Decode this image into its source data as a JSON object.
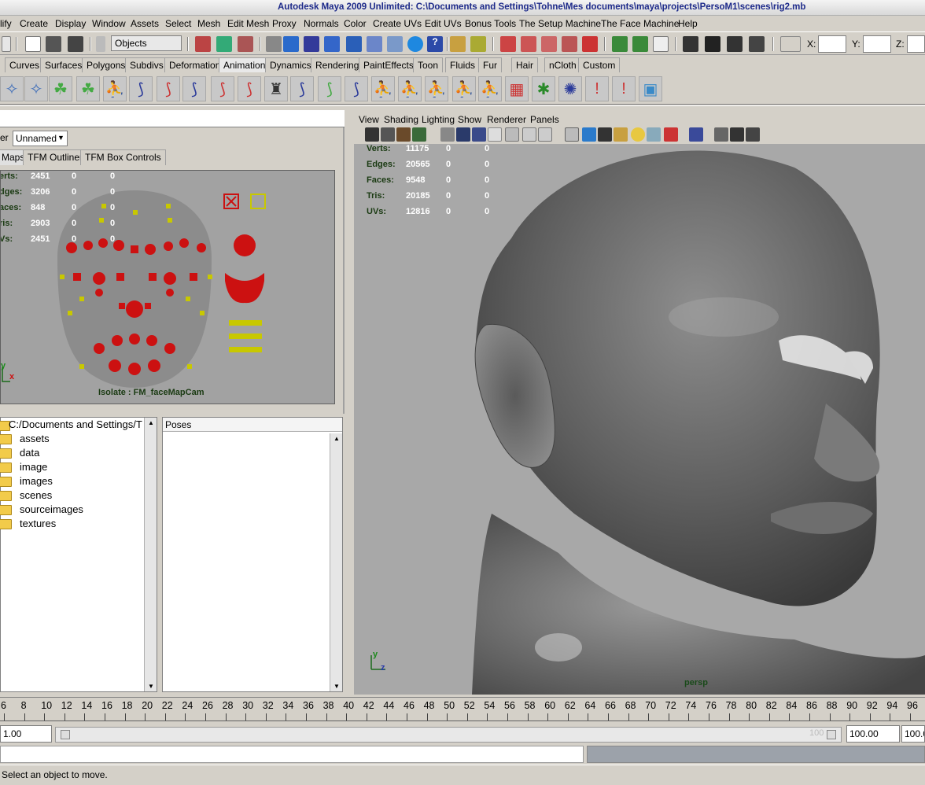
{
  "window": {
    "title": "Autodesk Maya 2009 Unlimited: C:\\Documents and Settings\\Tohne\\Mes documents\\maya\\projects\\PersoM1\\scenes\\rig2.mb"
  },
  "menubar": [
    "lify",
    "Create",
    "Display",
    "Window",
    "Assets",
    "Select",
    "Mesh",
    "Edit Mesh",
    "Proxy",
    "Normals",
    "Color",
    "Create UVs",
    "Edit UVs",
    "Bonus Tools",
    "The Setup Machine",
    "The Face Machine",
    "Help"
  ],
  "statusline": {
    "selection_mode": "Objects",
    "x_label": "X:",
    "y_label": "Y:",
    "z_label": "Z:"
  },
  "shelf_tabs": [
    "Curves",
    "Surfaces",
    "Polygons",
    "Subdivs",
    "Deformation",
    "Animation",
    "Dynamics",
    "Rendering",
    "PaintEffects",
    "Toon",
    "Fluids",
    "Fur",
    "Hair",
    "nCloth",
    "Custom"
  ],
  "shelf_active": "Animation",
  "left_panel": {
    "er_label": "er",
    "dropdown_value": "Unnamed",
    "tabs": [
      "Maps",
      "TFM Outliner",
      "TFM Box Controls"
    ],
    "active_tab": "Maps",
    "hud": [
      {
        "label": "erts:",
        "v1": "2451",
        "v2": "0",
        "v3": "0"
      },
      {
        "label": "dges:",
        "v1": "3206",
        "v2": "0",
        "v3": "0"
      },
      {
        "label": "aces:",
        "v1": "848",
        "v2": "0",
        "v3": "0"
      },
      {
        "label": "ris:",
        "v1": "2903",
        "v2": "0",
        "v3": "0"
      },
      {
        "label": "Vs:",
        "v1": "2451",
        "v2": "0",
        "v3": "0"
      }
    ],
    "isolate_label": "Isolate : FM_faceMapCam",
    "axis_x": "x",
    "axis_y": "y"
  },
  "file_browser": {
    "path": "C:/Documents and Settings/T",
    "folders": [
      "assets",
      "data",
      "image",
      "images",
      "scenes",
      "sourceimages",
      "textures"
    ]
  },
  "poses": {
    "header": "Poses"
  },
  "viewport": {
    "menu": [
      "View",
      "Shading",
      "Lighting",
      "Show",
      "Renderer",
      "Panels"
    ],
    "hud": [
      {
        "label": "Verts:",
        "v1": "11175",
        "v2": "0",
        "v3": "0"
      },
      {
        "label": "Edges:",
        "v1": "20565",
        "v2": "0",
        "v3": "0"
      },
      {
        "label": "Faces:",
        "v1": "9548",
        "v2": "0",
        "v3": "0"
      },
      {
        "label": "Tris:",
        "v1": "20185",
        "v2": "0",
        "v3": "0"
      },
      {
        "label": "UVs:",
        "v1": "12816",
        "v2": "0",
        "v3": "0"
      }
    ],
    "camera_label": "persp",
    "axis_y": "y",
    "axis_z": "z"
  },
  "timeslider": {
    "ticks": [
      "6",
      "8",
      "10",
      "12",
      "14",
      "16",
      "18",
      "20",
      "22",
      "24",
      "26",
      "28",
      "30",
      "32",
      "34",
      "36",
      "38",
      "40",
      "42",
      "44",
      "46",
      "48",
      "50",
      "52",
      "54",
      "56",
      "58",
      "60",
      "62",
      "64",
      "66",
      "68",
      "70",
      "72",
      "74",
      "76",
      "78",
      "80",
      "82",
      "84",
      "86",
      "88",
      "90",
      "92",
      "94",
      "96"
    ]
  },
  "range": {
    "start": "1.00",
    "slider_end": "100",
    "end": "100.00",
    "end2": "100.0"
  },
  "help_line": "Select an object to move."
}
